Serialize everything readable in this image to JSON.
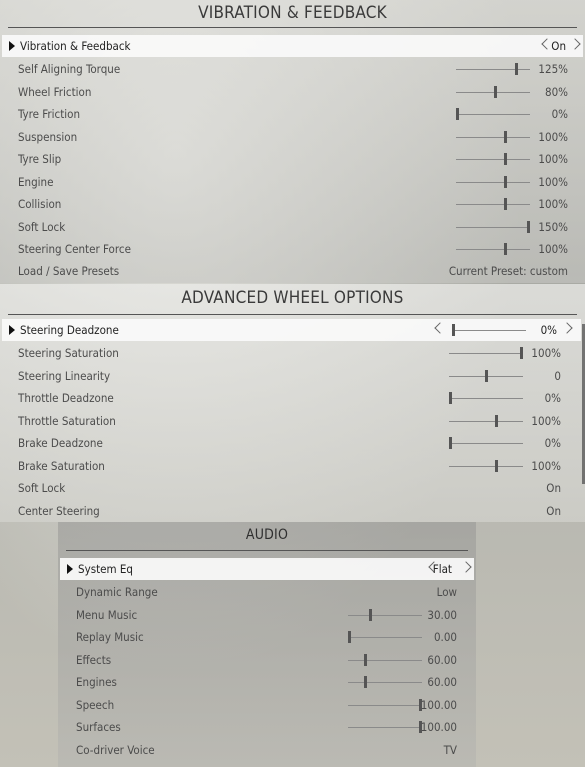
{
  "vibration": {
    "title": "VIBRATION & FEEDBACK",
    "selected": {
      "label": "Vibration & Feedback",
      "value": "On"
    },
    "rows": [
      {
        "label": "Self Aligning Torque",
        "value": "125%",
        "level": 0.83
      },
      {
        "label": "Wheel Friction",
        "value": "80%",
        "level": 0.53
      },
      {
        "label": "Tyre Friction",
        "value": "0%",
        "level": 0.0
      },
      {
        "label": "Suspension",
        "value": "100%",
        "level": 0.67
      },
      {
        "label": "Tyre Slip",
        "value": "100%",
        "level": 0.67
      },
      {
        "label": "Engine",
        "value": "100%",
        "level": 0.67
      },
      {
        "label": "Collision",
        "value": "100%",
        "level": 0.67
      },
      {
        "label": "Soft Lock",
        "value": "150%",
        "level": 1.0
      },
      {
        "label": "Steering Center Force",
        "value": "100%",
        "level": 0.67
      }
    ],
    "preset": {
      "label": "Load / Save Presets",
      "value": "Current Preset: custom"
    }
  },
  "wheel": {
    "title": "ADVANCED WHEEL OPTIONS",
    "selected": {
      "label": "Steering Deadzone",
      "value": "0%",
      "level": 0.0
    },
    "rows": [
      {
        "label": "Steering Saturation",
        "value": "100%",
        "level": 1.0,
        "slider": true
      },
      {
        "label": "Steering Linearity",
        "value": "0",
        "level": 0.5,
        "slider": true
      },
      {
        "label": "Throttle Deadzone",
        "value": "0%",
        "level": 0.0,
        "slider": true
      },
      {
        "label": "Throttle Saturation",
        "value": "100%",
        "level": 0.65,
        "slider": true
      },
      {
        "label": "Brake Deadzone",
        "value": "0%",
        "level": 0.0,
        "slider": true
      },
      {
        "label": "Brake Saturation",
        "value": "100%",
        "level": 0.65,
        "slider": true
      },
      {
        "label": "Soft Lock",
        "value": "On",
        "slider": false
      },
      {
        "label": "Center Steering",
        "value": "On",
        "slider": false
      }
    ]
  },
  "audio": {
    "title": "AUDIO",
    "selected": {
      "label": "System Eq",
      "value": "Flat"
    },
    "rows": [
      {
        "label": "Dynamic Range",
        "value": "Low",
        "slider": false
      },
      {
        "label": "Menu Music",
        "value": "30.00",
        "level": 0.3,
        "slider": true
      },
      {
        "label": "Replay Music",
        "value": "0.00",
        "level": 0.0,
        "slider": true
      },
      {
        "label": "Effects",
        "value": "60.00",
        "level": 0.22,
        "slider": true
      },
      {
        "label": "Engines",
        "value": "60.00",
        "level": 0.22,
        "slider": true
      },
      {
        "label": "Speech",
        "value": "100.00",
        "level": 1.0,
        "slider": true
      },
      {
        "label": "Surfaces",
        "value": "100.00",
        "level": 1.0,
        "slider": true
      },
      {
        "label": "Co-driver Voice",
        "value": "TV",
        "slider": false
      }
    ]
  }
}
